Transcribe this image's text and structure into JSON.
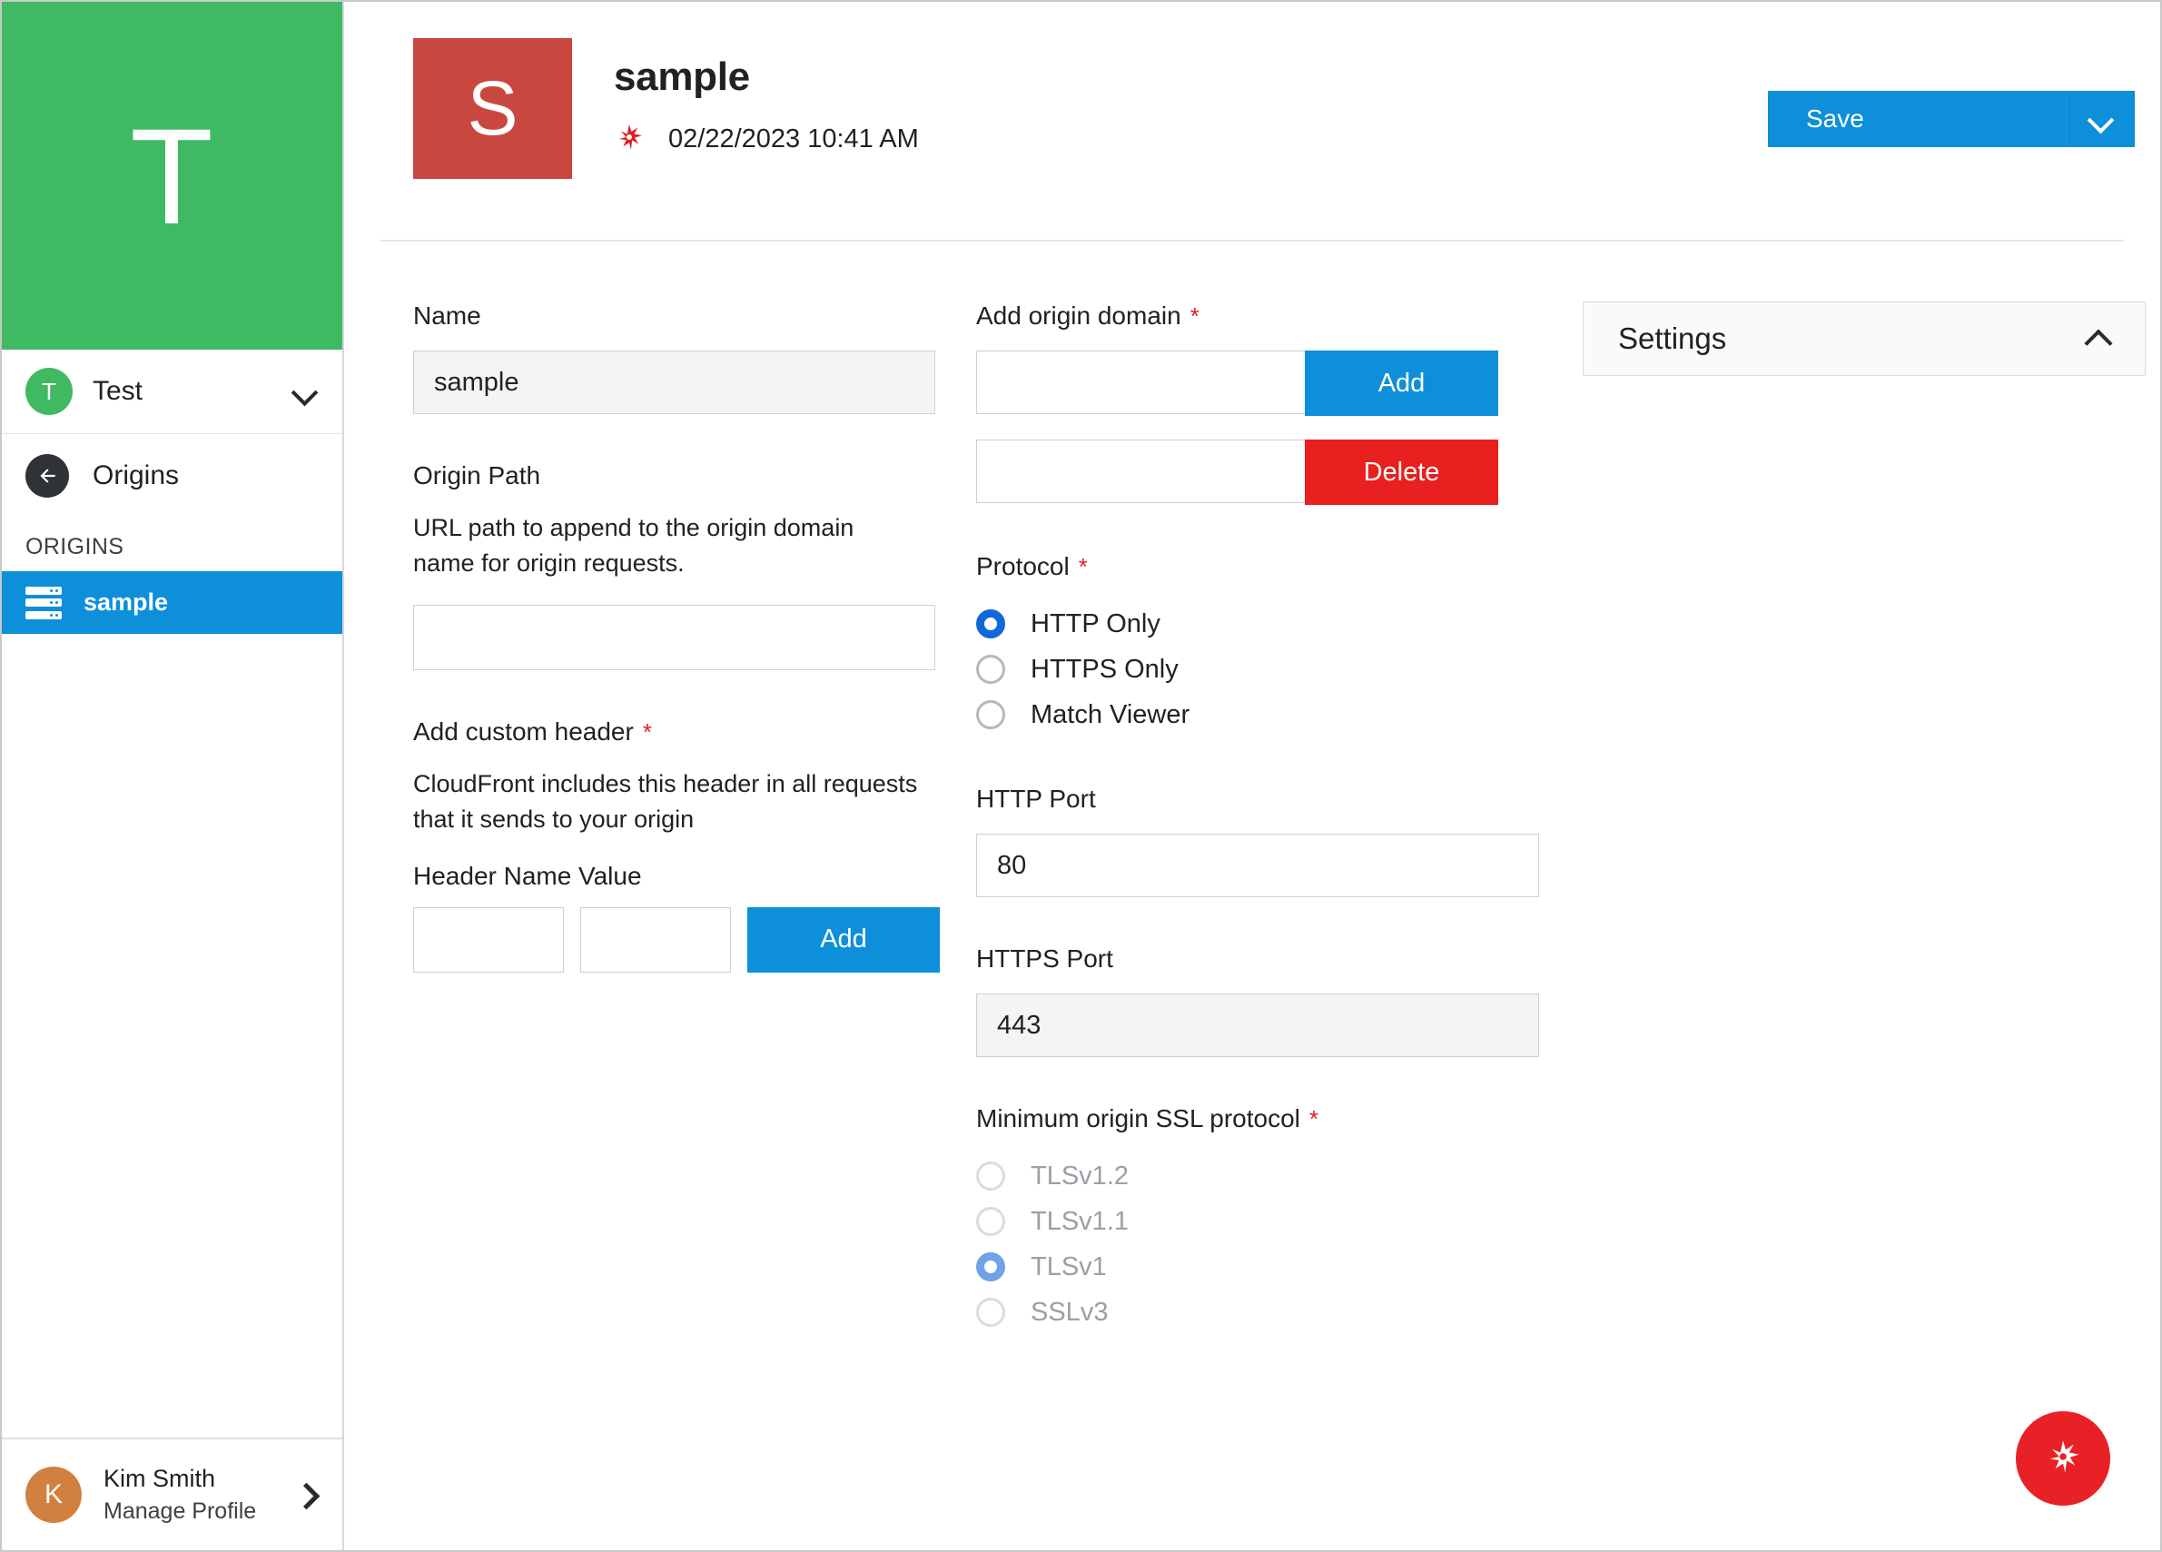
{
  "sidebar": {
    "brand_letter": "T",
    "workspace": {
      "avatar_letter": "T",
      "name": "Test",
      "chevron_icon": "chevron-down-icon"
    },
    "back": {
      "label": "Origins",
      "icon": "arrow-left-circle-icon"
    },
    "section_label": "ORIGINS",
    "nav_items": [
      {
        "label": "sample",
        "icon": "server-icon",
        "active": true
      }
    ],
    "profile": {
      "avatar_letter": "K",
      "name": "Kim Smith",
      "subtitle": "Manage Profile",
      "chevron_icon": "chevron-right-icon"
    }
  },
  "header": {
    "tile_letter": "S",
    "title": "sample",
    "meta_icon": "sparkle-icon",
    "timestamp": "02/22/2023 10:41 AM",
    "save_label": "Save",
    "save_chevron_icon": "chevron-down-icon"
  },
  "form": {
    "name": {
      "label": "Name",
      "value": "sample"
    },
    "origin_path": {
      "label": "Origin Path",
      "help": "URL path to append to the origin domain name for origin requests.",
      "value": ""
    },
    "custom_header": {
      "label": "Add custom header",
      "required": "*",
      "help": "CloudFront includes this header in all requests that it sends to your origin",
      "name_label": "Header Name",
      "value_label": "Value",
      "name_value": "",
      "value_value": "",
      "add_label": "Add"
    },
    "origin_domain": {
      "label": "Add origin domain",
      "required": "*",
      "add_value": "",
      "add_label": "Add",
      "delete_value": "",
      "delete_label": "Delete"
    },
    "protocol": {
      "label": "Protocol",
      "required": "*",
      "options": [
        {
          "label": "HTTP Only",
          "checked": true
        },
        {
          "label": "HTTPS Only",
          "checked": false
        },
        {
          "label": "Match Viewer",
          "checked": false
        }
      ]
    },
    "http_port": {
      "label": "HTTP Port",
      "value": "80"
    },
    "https_port": {
      "label": "HTTPS Port",
      "value": "443"
    },
    "ssl_protocol": {
      "label": "Minimum origin SSL protocol",
      "required": "*",
      "options": [
        {
          "label": "TLSv1.2",
          "checked": false
        },
        {
          "label": "TLSv1.1",
          "checked": false
        },
        {
          "label": "TLSv1",
          "checked": true
        },
        {
          "label": "SSLv3",
          "checked": false
        }
      ]
    }
  },
  "settings_panel": {
    "title": "Settings",
    "collapse_icon": "chevron-up-icon"
  },
  "fab": {
    "icon": "sparkle-icon"
  },
  "colors": {
    "brand_green": "#3fba63",
    "doc_red": "#c8483f",
    "accent_blue": "#0d8fd9",
    "danger_red": "#e8201f",
    "profile_orange": "#d2803f",
    "required_star": "#e02020",
    "radio_blue": "#1168d8"
  }
}
